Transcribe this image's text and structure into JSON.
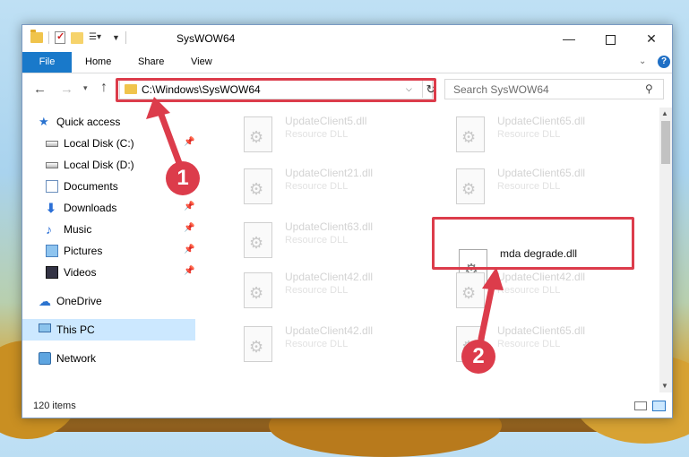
{
  "window": {
    "title": "SysWOW64"
  },
  "ribbon": {
    "tabs": [
      "File",
      "Home",
      "Share",
      "View"
    ]
  },
  "nav": {
    "address": "C:\\Windows\\SysWOW64",
    "search_placeholder": "Search SysWOW64"
  },
  "sidebar": {
    "items": [
      {
        "label": "Quick access",
        "icon": "star-icon",
        "pinned": false
      },
      {
        "label": "Local Disk (C:)",
        "icon": "disk-icon",
        "pinned": true
      },
      {
        "label": "Local Disk (D:)",
        "icon": "disk-icon",
        "pinned": false
      },
      {
        "label": "Documents",
        "icon": "documents-icon",
        "pinned": true
      },
      {
        "label": "Downloads",
        "icon": "download-icon",
        "pinned": true
      },
      {
        "label": "Music",
        "icon": "music-icon",
        "pinned": true
      },
      {
        "label": "Pictures",
        "icon": "pictures-icon",
        "pinned": true
      },
      {
        "label": "Videos",
        "icon": "videos-icon",
        "pinned": true
      },
      {
        "label": "OneDrive",
        "icon": "cloud-icon",
        "pinned": false
      },
      {
        "label": "This PC",
        "icon": "computer-icon",
        "pinned": false,
        "selected": true
      },
      {
        "label": "Network",
        "icon": "network-icon",
        "pinned": false
      }
    ]
  },
  "files": [
    {
      "name": "UpdateClient5.dll",
      "type": "Resource DLL"
    },
    {
      "name": "UpdateClient65.dll",
      "type": "Resource DLL"
    },
    {
      "name": "UpdateClient21.dll",
      "type": "Resource DLL"
    },
    {
      "name": "UpdateClient65.dll",
      "type": "Resource DLL"
    },
    {
      "name": "UpdateClient63.dll",
      "type": "Resource DLL"
    },
    {
      "name": "mda degrade.dll",
      "type": ""
    },
    {
      "name": "UpdateClient42.dll",
      "type": "Resource DLL"
    },
    {
      "name": "UpdateClient42.dll",
      "type": "Resource DLL"
    },
    {
      "name": "UpdateClient42.dll",
      "type": "Resource DLL"
    },
    {
      "name": "UpdateClient65.dll",
      "type": "Resource DLL"
    }
  ],
  "status": {
    "item_count": "120 items"
  },
  "annotations": {
    "step1": "1",
    "step2": "2",
    "color": "#dc3c4b"
  }
}
